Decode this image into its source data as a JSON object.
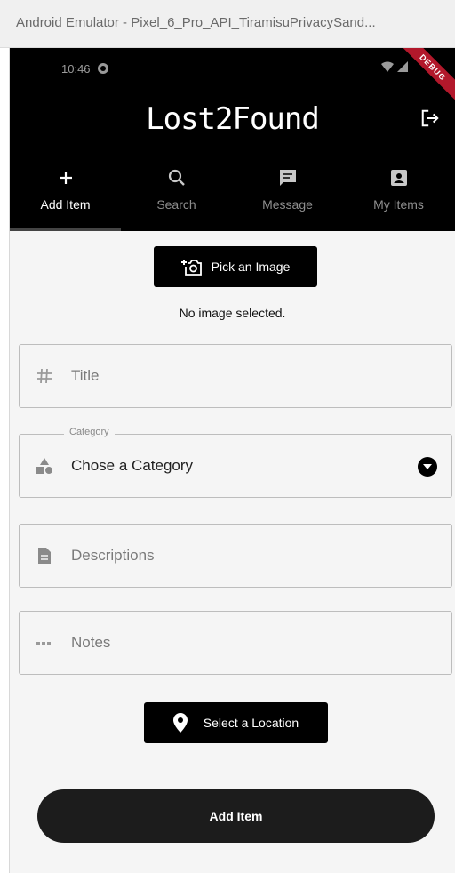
{
  "window": {
    "title": "Android Emulator - Pixel_6_Pro_API_TiramisuPrivacySand..."
  },
  "status_bar": {
    "time": "10:46",
    "debug_badge": "DEBUG"
  },
  "app": {
    "title": "Lost2Found"
  },
  "nav": {
    "items": [
      {
        "label": "Add Item",
        "icon": "plus-icon",
        "active": true
      },
      {
        "label": "Search",
        "icon": "search-icon",
        "active": false
      },
      {
        "label": "Message",
        "icon": "message-icon",
        "active": false
      },
      {
        "label": "My Items",
        "icon": "account-box-icon",
        "active": false
      }
    ]
  },
  "form": {
    "pick_image_label": "Pick an Image",
    "no_image_text": "No image selected.",
    "title_placeholder": "Title",
    "category_label": "Category",
    "category_value": "Chose a Category",
    "description_placeholder": "Descriptions",
    "notes_placeholder": "Notes",
    "location_label": "Select a Location",
    "submit_label": "Add Item"
  },
  "colors": {
    "appbar": "#000000",
    "background": "#f5f5f5",
    "nav_inactive": "#8e8e8e",
    "debug": "#b2182b"
  }
}
